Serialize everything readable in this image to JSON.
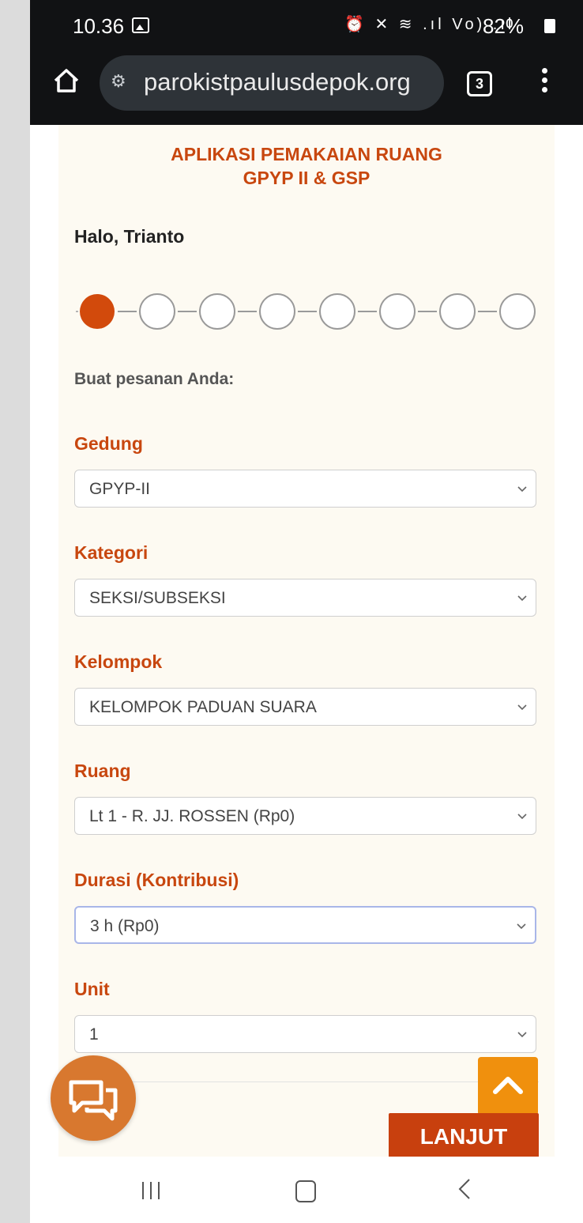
{
  "status_bar": {
    "time": "10.36",
    "icons_text": "⏰ ✕ ≋ .ıl Vo) .ıl",
    "battery": "82%"
  },
  "browser": {
    "url": "parokistpaulusdepok.org",
    "tab_count": "3"
  },
  "page": {
    "title_line1": "APLIKASI PEMAKAIAN RUANG",
    "title_line2": "GPYP II & GSP",
    "greeting": "Halo, Trianto",
    "instruction": "Buat pesanan Anda:",
    "steps": {
      "total": 8,
      "current": 1
    },
    "fields": [
      {
        "label": "Gedung",
        "value": "GPYP-II"
      },
      {
        "label": "Kategori",
        "value": "SEKSI/SUBSEKSI"
      },
      {
        "label": "Kelompok",
        "value": "KELOMPOK PADUAN SUARA"
      },
      {
        "label": "Ruang",
        "value": "Lt 1 - R. JJ. ROSSEN (Rp0)"
      },
      {
        "label": "Durasi (Kontribusi)",
        "value": "3 h (Rp0)"
      },
      {
        "label": "Unit",
        "value": "1"
      }
    ],
    "next_button": "LANJUT"
  },
  "colors": {
    "accent": "#c8470f",
    "card_bg": "#fdfaf2",
    "chat_button": "#d8782f",
    "scroll_top": "#f0900d",
    "next_button": "#c8400e"
  },
  "icons": [
    "home-icon",
    "site-info-icon",
    "tabs-icon",
    "menu-icon",
    "chat-icon",
    "chevron-up-icon",
    "recent-apps-icon",
    "home-nav-icon",
    "back-icon"
  ]
}
